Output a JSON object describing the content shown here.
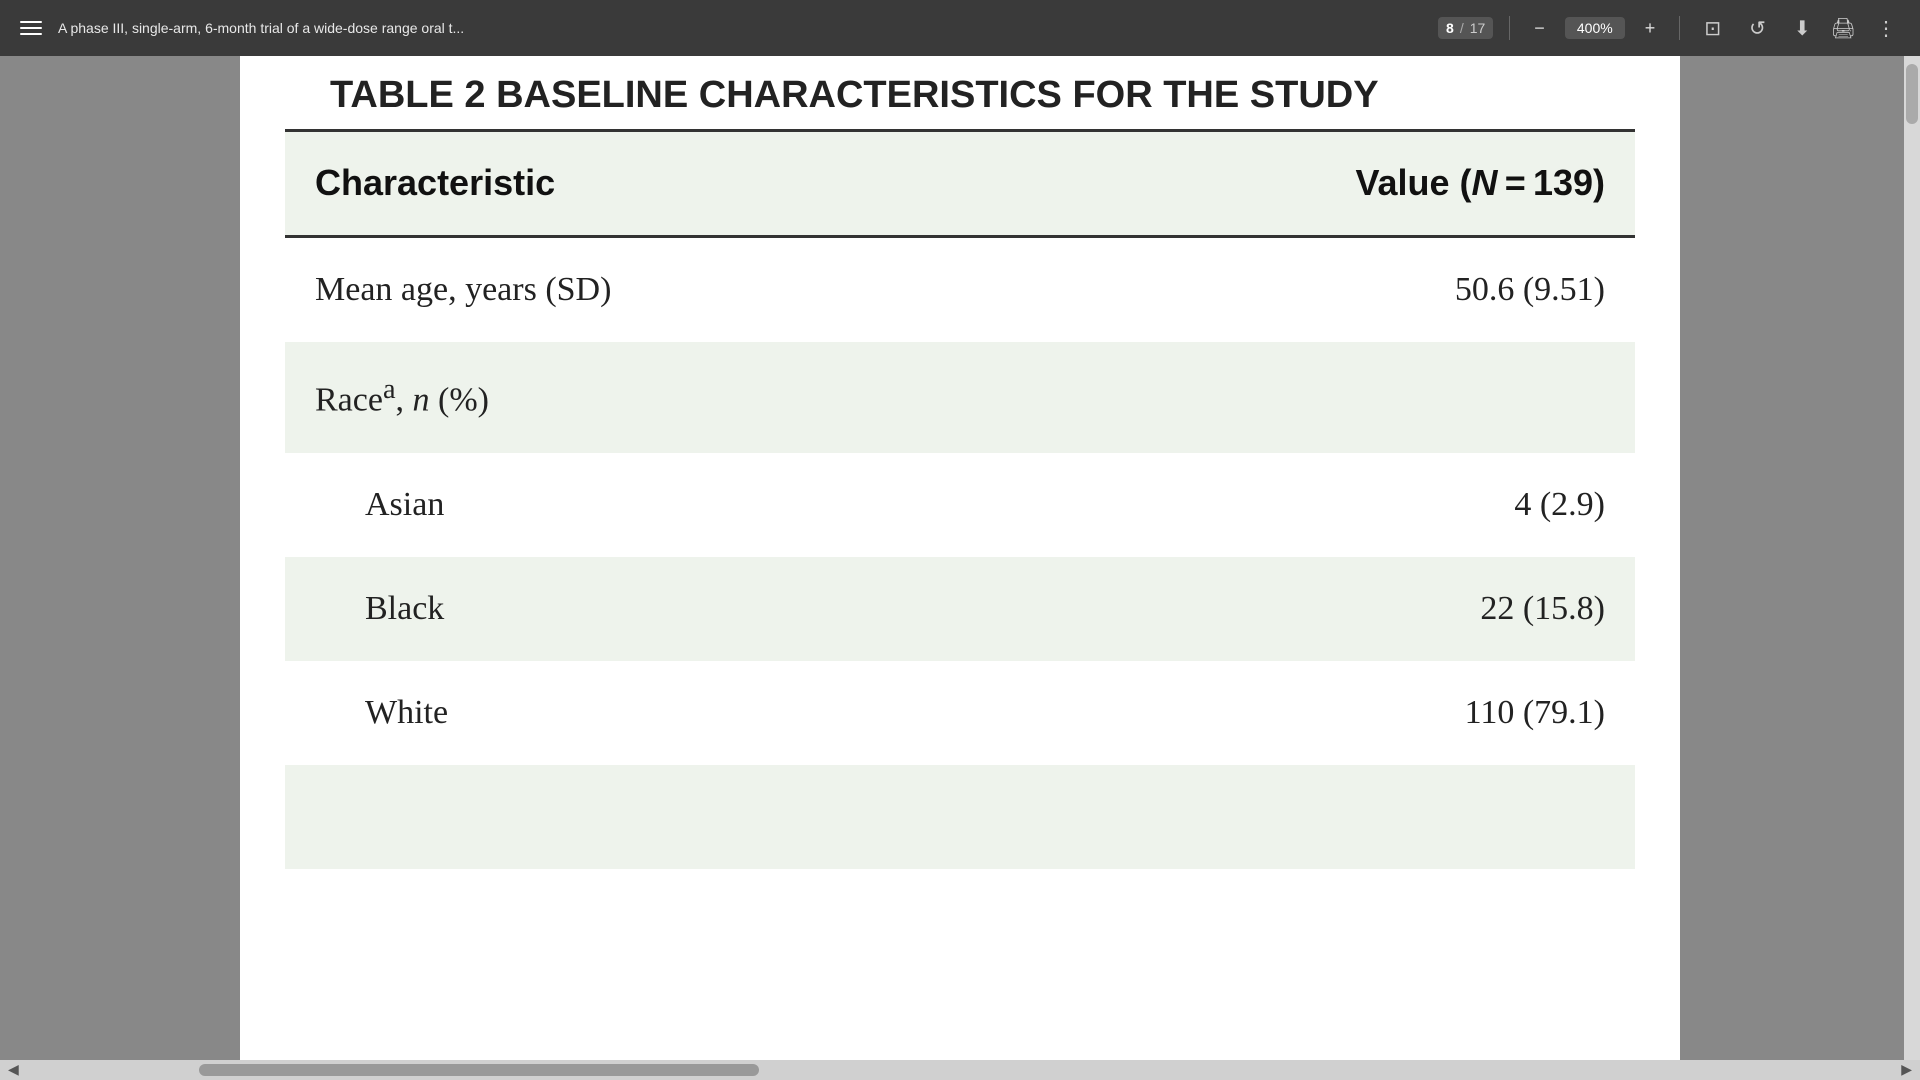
{
  "toolbar": {
    "menu_label": "Menu",
    "title": "A phase III, single-arm, 6-month trial of a wide-dose range oral t...",
    "page_current": "8",
    "page_total": "17",
    "zoom": "400%",
    "zoom_out_label": "−",
    "zoom_in_label": "+",
    "fit_icon": "fit-page-icon",
    "history_icon": "history-icon",
    "download_icon": "download-icon",
    "print_icon": "print-icon",
    "more_icon": "more-options-icon"
  },
  "partial_heading": "TABLE 2 BASELINE CHARACTERISTICS FOR THE STUDY",
  "table": {
    "header": {
      "col1": "Characteristic",
      "col2": "Value (N = 139)"
    },
    "rows": [
      {
        "id": "mean-age",
        "shaded": false,
        "indent": false,
        "characteristic": "Mean age, years (SD)",
        "value": "50.6 (9.51)"
      },
      {
        "id": "race",
        "shaded": true,
        "indent": false,
        "characteristic": "Raceᵃ, n (%)",
        "value": ""
      },
      {
        "id": "asian",
        "shaded": false,
        "indent": true,
        "characteristic": "Asian",
        "value": "4 (2.9)"
      },
      {
        "id": "black",
        "shaded": true,
        "indent": true,
        "characteristic": "Black",
        "value": "22 (15.8)"
      },
      {
        "id": "white",
        "shaded": false,
        "indent": true,
        "characteristic": "White",
        "value": "110 (79.1)"
      }
    ]
  },
  "scrollbar": {
    "left_arrow": "◀",
    "right_arrow": "▶"
  }
}
